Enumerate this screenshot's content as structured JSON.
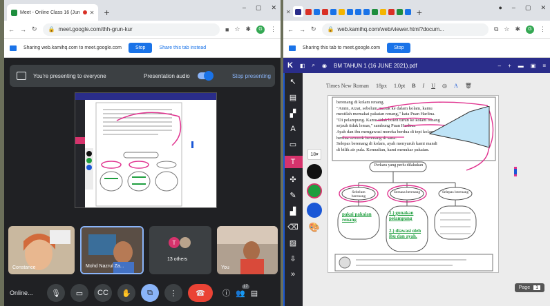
{
  "left_window": {
    "tab_title": "Meet - Online Class 16 (Jun",
    "url": "meet.google.com/thh-grun-kur",
    "sharing_text": "Sharing web.kamihq.com to meet.google.com",
    "stop_label": "Stop",
    "share_instead_label": "Share this tab instead",
    "presenting_text": "You're presenting to everyone",
    "presentation_audio_label": "Presentation audio",
    "stop_presenting_label": "Stop presenting",
    "participants": [
      {
        "name": "Constance"
      },
      {
        "name": "Mohd Nazrul Za..."
      },
      {
        "name": "13 others"
      },
      {
        "name": "You"
      }
    ],
    "meeting_name": "Online...",
    "participant_count": "17"
  },
  "right_window": {
    "url": "web.kamihq.com/web/viewer.html?docum...",
    "sharing_text": "Sharing this tab to meet.google.com",
    "stop_label": "Stop",
    "doc_title": "BM TAHUN 1 (16 JUNE 2021).pdf",
    "font_name": "Times New Roman",
    "font_size": "18px",
    "line_spacing": "1.0pt",
    "text_size_badge": "18",
    "page_label": "Page",
    "page_number": "1"
  },
  "document": {
    "paragraph_lines": [
      "berenang di kolam renang.",
      "\"Amin, Aizat, sebelum masuk ke dalam kolam, kamu",
      "mestilah memakai pakaian renang,\" kata Puan Harlina.",
      "\"Di pelampung. Kamu tidak boleh turun ke kolam renang",
      "sejauh tidak lemas,\" sambung Puan Harlina.",
      "Ayah dan ibu mengawasi mereka berdua di tepi kolam. Kini",
      "berdua seronok berenang di sana.",
      "Selepas berenang di kolam, ayah menyuruh kami mandi",
      "di bilik air pula. Kemudian, kami menukar pakaian."
    ],
    "diagram_title": "Perkara yang perlu dilakukan",
    "boxes": [
      "Sebelum berenang",
      "Semasa berenang",
      "Selepas berenang"
    ],
    "answers": [
      "pakai pakaian renang",
      "1.) gunakan pelampung",
      "2.) diawasi oleh ibu dan ayah."
    ]
  },
  "colors": {
    "kami_accent": "#d6336c",
    "kami_header": "#2a2d8a",
    "meet_bg": "#202124",
    "chrome_blue": "#1a73e8",
    "annotation_pink": "#e0338f",
    "annotation_green": "#1e9e3e"
  }
}
